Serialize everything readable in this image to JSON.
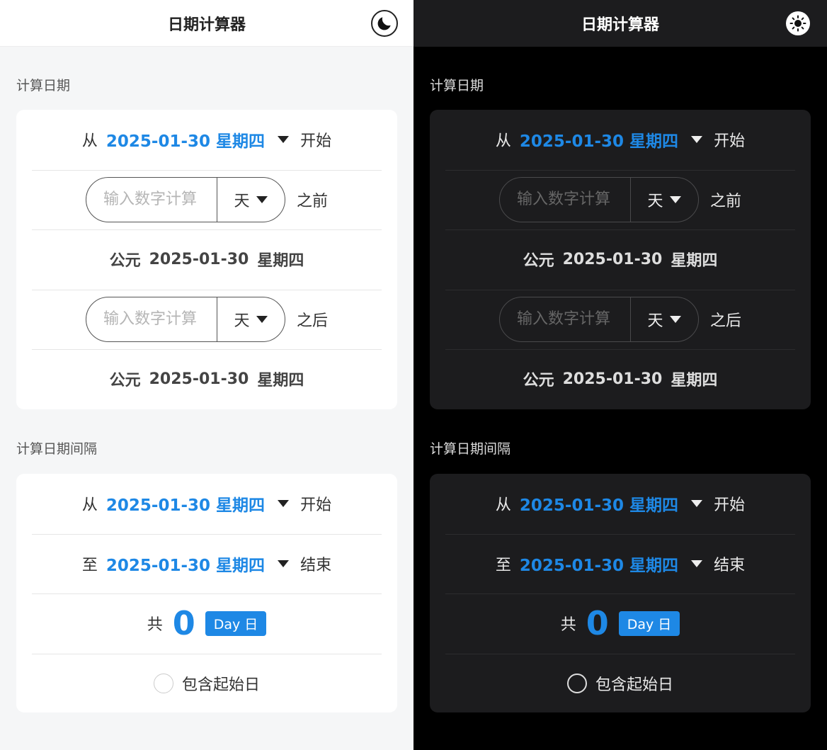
{
  "app": {
    "title": "日期计算器"
  },
  "sections": {
    "calc": {
      "title": "计算日期"
    },
    "interval": {
      "title": "计算日期间隔"
    }
  },
  "calc": {
    "from_prefix": "从",
    "start_date": "2025-01-30 星期四",
    "from_suffix": "开始",
    "input_placeholder": "输入数字计算",
    "unit": "天",
    "before_label": "之前",
    "after_label": "之后",
    "result_era": "公元",
    "result_date": "2025-01-30",
    "result_weekday": "星期四"
  },
  "interval": {
    "from_prefix": "从",
    "start_date": "2025-01-30 星期四",
    "from_suffix": "开始",
    "to_prefix": "至",
    "end_date": "2025-01-30 星期四",
    "to_suffix": "结束",
    "total_prefix": "共",
    "total_value": "0",
    "unit_badge": "Day  日",
    "include_start_label": "包含起始日"
  },
  "colors": {
    "accent": "#1e88e5",
    "dark_bg": "#000000",
    "dark_card": "#1c1c1e",
    "light_bg": "#f5f6f7"
  },
  "icons": {
    "light_theme_toggle": "moon-icon",
    "dark_theme_toggle": "sun-icon"
  }
}
